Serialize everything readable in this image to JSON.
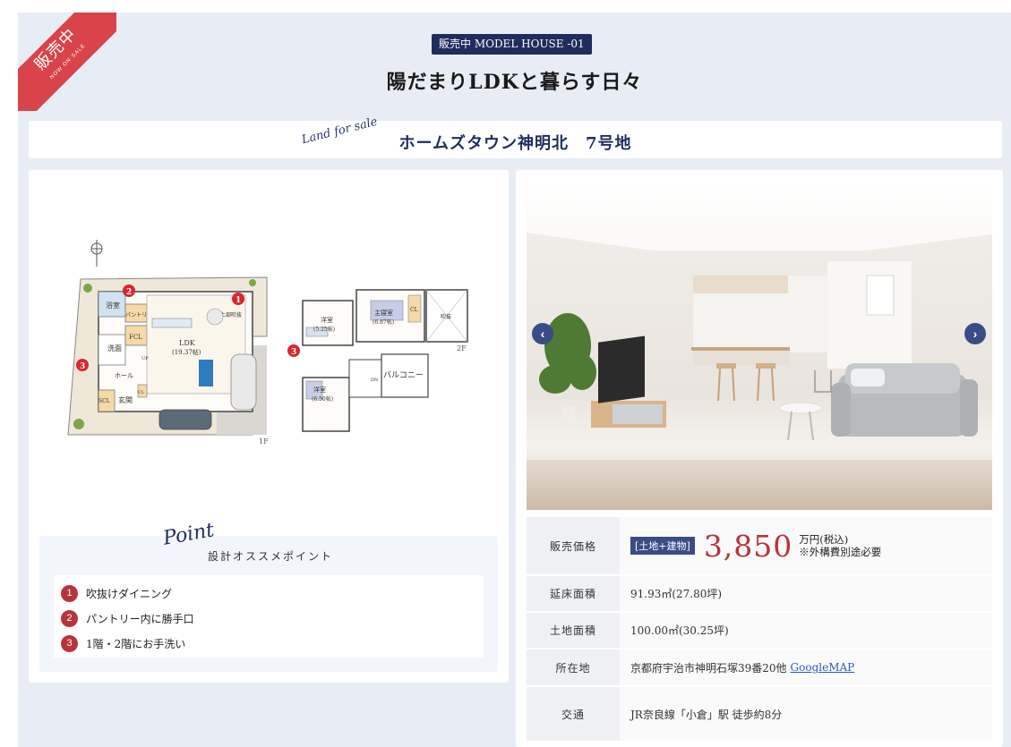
{
  "ribbon": {
    "main": "販売中",
    "sub": "NOW ON SALE"
  },
  "badge": "販売中 MODEL HOUSE -01",
  "title": "陽だまりLDKと暮らす日々",
  "land": {
    "script": "Land for sale",
    "name": "ホームズタウン神明北　7号地"
  },
  "floorplan": {
    "floor1_rooms": [
      "浴室",
      "パントリー",
      "洗面",
      "FCL",
      "LDK",
      "(19.37帖)",
      "上部吹抜",
      "ホール",
      "SCL",
      "玄関",
      "CL",
      "UP"
    ],
    "floor1_label": "1F",
    "floor2_rooms": [
      "洋室",
      "(5.25帖)",
      "主寝室",
      "(6.87帖)",
      "CL",
      "吹抜",
      "洋室",
      "(6.50帖)",
      "バルコニー",
      "DN"
    ],
    "floor2_label": "2F",
    "markers": [
      "1",
      "2",
      "3"
    ]
  },
  "points": {
    "script": "Point",
    "subtitle": "設計オススメポイント",
    "items": [
      {
        "num": "1",
        "text": "吹抜けダイニング"
      },
      {
        "num": "2",
        "text": "パントリー内に勝手口"
      },
      {
        "num": "3",
        "text": "1階・2階にお手洗い"
      }
    ]
  },
  "slider": {
    "prev": "‹",
    "next": "›"
  },
  "spec": {
    "price_label": "販売価格",
    "price_tag": "[土地+建物]",
    "price_value": "3,850",
    "price_unit": "万円(税込)",
    "price_note": "※外構費別途必要",
    "floor_area_label": "延床面積",
    "floor_area": "91.93㎡(27.80坪)",
    "land_area_label": "土地面積",
    "land_area": "100.00㎡(30.25坪)",
    "address_label": "所在地",
    "address": "京都府宇治市神明石塚39番20他",
    "map_link": "GoogleMAP",
    "access_label": "交通",
    "access": "JR奈良線「小倉」駅 徒歩約8分"
  },
  "colors": {
    "navy": "#1e2d5e",
    "ribbon_red": "#d9434a",
    "price_red": "#b8333a",
    "panel_bg": "#e8edf5"
  }
}
